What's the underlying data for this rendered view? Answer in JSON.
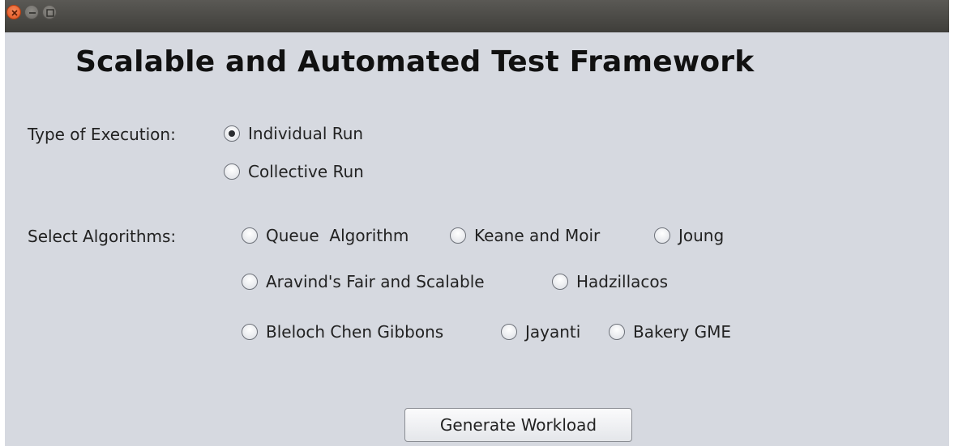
{
  "window": {
    "controls": [
      "close-icon",
      "minimize-icon",
      "maximize-icon"
    ]
  },
  "app": {
    "title": "Scalable and Automated Test Framework"
  },
  "execution": {
    "label": "Type of Execution:",
    "options": [
      {
        "label": "Individual Run",
        "selected": true
      },
      {
        "label": "Collective Run",
        "selected": false
      }
    ]
  },
  "algorithms": {
    "label": "Select Algorithms:",
    "options": [
      {
        "label": "Queue  Algorithm",
        "selected": false
      },
      {
        "label": "Keane and Moir",
        "selected": false
      },
      {
        "label": "Joung",
        "selected": false
      },
      {
        "label": "Aravind's Fair and Scalable",
        "selected": false
      },
      {
        "label": "Hadzillacos",
        "selected": false
      },
      {
        "label": "Bleloch Chen Gibbons",
        "selected": false
      },
      {
        "label": "Jayanti",
        "selected": false
      },
      {
        "label": "Bakery GME",
        "selected": false
      }
    ]
  },
  "actions": {
    "generate_label": "Generate Workload"
  },
  "colors": {
    "titlebar": "#3f3e3a",
    "window_bg": "#d6d9e0",
    "close_button": "#e2511c"
  }
}
